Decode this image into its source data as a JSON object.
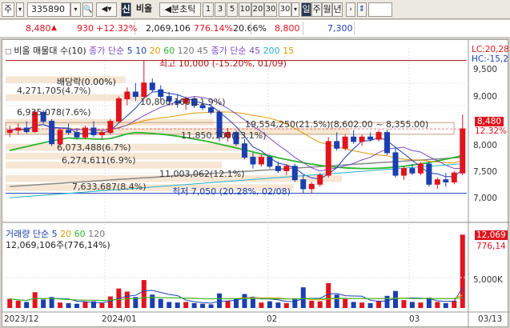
{
  "toolbar": {
    "market": "주",
    "code": "335890",
    "name": "비올",
    "ann": "분초틱",
    "tfs": [
      "1",
      "3",
      "5",
      "10",
      "20",
      "30"
    ],
    "sel_tf": "30",
    "days": [
      "일",
      "주",
      "월",
      "년"
    ]
  },
  "pricebar": {
    "price": "8,480",
    "change": "930",
    "rate": "+12.32%",
    "volume": "2,069,106",
    "vol_ratio": "776.14%",
    "turnover": "20.66%",
    "f1": "8,800",
    "f2": "7,300"
  },
  "chart_data": {
    "type": "candlestick",
    "price_legend": {
      "title": "비올 매물대 수(10)",
      "ma": "종가 단순",
      "periods": [
        "5",
        "10",
        "20",
        "60",
        "120",
        "45"
      ],
      "env": "종가 단순 45",
      "env_p": [
        "200",
        "15"
      ]
    },
    "vol_legend": {
      "title": "거래량 단순",
      "periods": [
        "5",
        "20",
        "60",
        "120"
      ],
      "value": "12,069,106주(776,14%)"
    },
    "annotations": {
      "high": "최고 10,000 (-15.20%, 01/09)",
      "low": "최저 7,050 (20.28%, 02/08)",
      "dividend": "배당락(0.00%)",
      "lc": "LC:20,28",
      "hc": "HC:-15,2",
      "current": "8,480",
      "current_pct": "12.32%",
      "vol_current": "12,069",
      "vol_sub": "776,14"
    },
    "volume_profile": [
      {
        "label": "",
        "pct": ""
      },
      {
        "label": "4,271,705(4.7%)"
      },
      {
        "label": "6,935,078(7.6%)"
      },
      {
        "label": "6,073,488(6.7%)"
      },
      {
        "label": "6,274,611(6.9%)"
      },
      {
        "label": "11,003,062(12.1%)"
      },
      {
        "label": "7,633,687(8.4%)"
      },
      {
        "label": "10,800,160(11.9%)"
      },
      {
        "label": "11,850,100(13.1%)"
      },
      {
        "label": "19,554,250(21.5%)(8,602.00 ~ 8,355.00)"
      }
    ],
    "y_ticks": [
      "9,500",
      "9,000",
      "8,500",
      "8,000",
      "7,500",
      "7,000"
    ],
    "vol_ticks": [
      "5,000K"
    ],
    "x_ticks": [
      "2023/12",
      "2024/01",
      "02",
      "03",
      "03/13"
    ],
    "candles": [
      [
        8400,
        8550,
        8300,
        8450
      ],
      [
        8450,
        8600,
        8350,
        8500
      ],
      [
        8500,
        8650,
        8380,
        8420
      ],
      [
        8420,
        8900,
        8400,
        8850
      ],
      [
        8850,
        8900,
        8600,
        8650
      ],
      [
        8650,
        8700,
        8100,
        8150
      ],
      [
        8150,
        8500,
        8100,
        8450
      ],
      [
        8450,
        8600,
        8350,
        8400
      ],
      [
        8400,
        8500,
        8250,
        8300
      ],
      [
        8300,
        8550,
        8250,
        8500
      ],
      [
        8500,
        8650,
        8300,
        8350
      ],
      [
        8350,
        8450,
        8250,
        8400
      ],
      [
        8400,
        8700,
        8350,
        8650
      ],
      [
        8650,
        9200,
        8600,
        9150
      ],
      [
        9150,
        9400,
        9000,
        9300
      ],
      [
        9300,
        9500,
        9100,
        9200
      ],
      [
        9200,
        10000,
        9150,
        9500
      ],
      [
        9500,
        9600,
        9300,
        9350
      ],
      [
        9350,
        9450,
        9100,
        9200
      ],
      [
        9200,
        9300,
        9000,
        9100
      ],
      [
        9100,
        9250,
        8950,
        9050
      ],
      [
        9050,
        9200,
        8900,
        9150
      ],
      [
        9150,
        9200,
        8950,
        9000
      ],
      [
        9000,
        9100,
        8900,
        8950
      ],
      [
        8950,
        9000,
        8800,
        8850
      ],
      [
        8850,
        8900,
        8200,
        8300
      ],
      [
        8300,
        8500,
        8200,
        8400
      ],
      [
        8400,
        8450,
        8100,
        8150
      ],
      [
        8150,
        8250,
        7800,
        7850
      ],
      [
        7850,
        7950,
        7600,
        7700
      ],
      [
        7700,
        7900,
        7650,
        7850
      ],
      [
        7850,
        7900,
        7600,
        7650
      ],
      [
        7650,
        7750,
        7500,
        7550
      ],
      [
        7550,
        7700,
        7450,
        7650
      ],
      [
        7650,
        7700,
        7300,
        7350
      ],
      [
        7350,
        7450,
        7050,
        7150
      ],
      [
        7150,
        7300,
        7050,
        7250
      ],
      [
        7250,
        7500,
        7200,
        7450
      ],
      [
        7450,
        8300,
        7400,
        8200
      ],
      [
        8200,
        8400,
        8000,
        8050
      ],
      [
        8050,
        8350,
        8000,
        8300
      ],
      [
        8300,
        8450,
        8150,
        8200
      ],
      [
        8200,
        8350,
        8100,
        8300
      ],
      [
        8300,
        8400,
        8200,
        8250
      ],
      [
        8250,
        8450,
        8200,
        8400
      ],
      [
        8400,
        8450,
        7900,
        7950
      ],
      [
        7950,
        8050,
        7400,
        7450
      ],
      [
        7450,
        7650,
        7350,
        7600
      ],
      [
        7600,
        7700,
        7450,
        7500
      ],
      [
        7500,
        7750,
        7450,
        7700
      ],
      [
        7700,
        7750,
        7200,
        7250
      ],
      [
        7250,
        7400,
        7150,
        7350
      ],
      [
        7350,
        7500,
        7200,
        7300
      ],
      [
        7300,
        7550,
        7250,
        7500
      ],
      [
        7500,
        8800,
        7450,
        8480
      ]
    ],
    "volumes": [
      1.5,
      1.2,
      1.0,
      2.6,
      1.4,
      1.8,
      0.9,
      0.8,
      0.7,
      1.0,
      1.1,
      0.8,
      1.9,
      3.2,
      2.7,
      1.8,
      4.6,
      2.2,
      1.5,
      1.0,
      0.9,
      1.0,
      0.8,
      0.7,
      0.6,
      2.4,
      1.2,
      1.5,
      2.3,
      1.6,
      0.9,
      1.1,
      0.9,
      0.8,
      1.6,
      3.4,
      1.2,
      1.1,
      4.1,
      2.2,
      1.5,
      1.0,
      0.9,
      0.8,
      1.2,
      2.0,
      2.8,
      1.3,
      1.0,
      0.9,
      1.7,
      1.0,
      0.8,
      1.2,
      12.069
    ]
  }
}
